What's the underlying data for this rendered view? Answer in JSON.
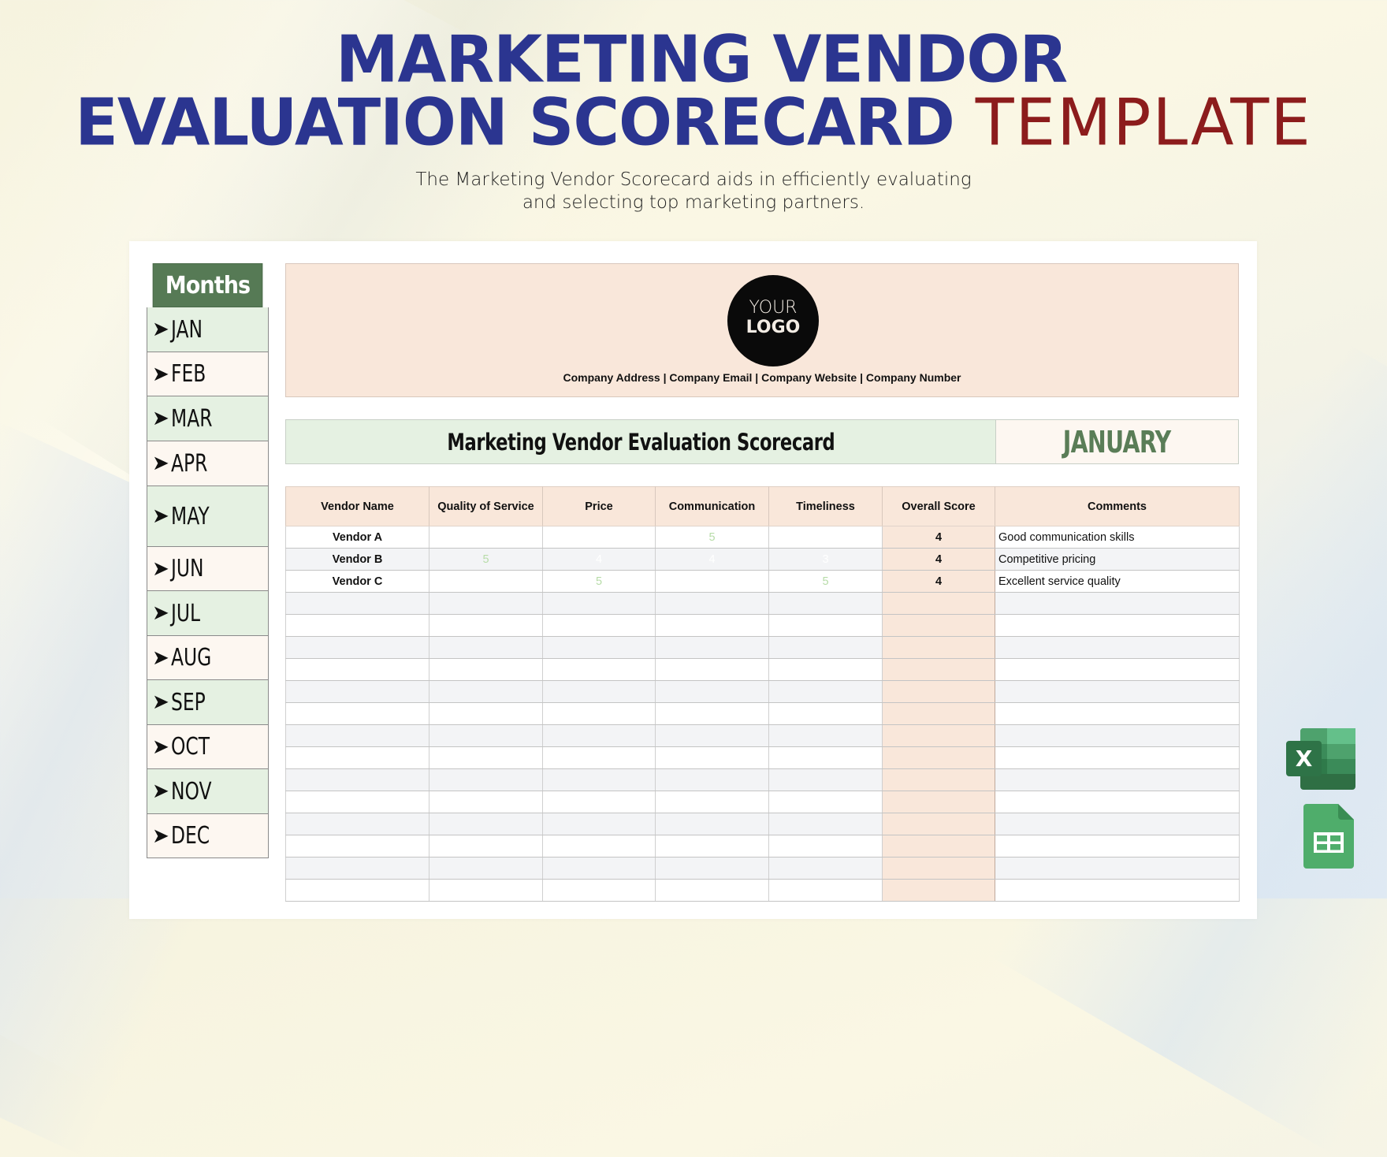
{
  "hero": {
    "title_line1": "MARKETING VENDOR",
    "title_line2_bold": "EVALUATION SCORECARD",
    "title_line2_light": "TEMPLATE",
    "subtitle_line1": "The Marketing Vendor Scorecard aids in efficiently evaluating",
    "subtitle_line2": "and selecting top marketing partners."
  },
  "colors": {
    "title_blue": "#2b3590",
    "template_red": "#8c1c1c",
    "months_header_green": "#567a55",
    "month_green": "#e5f1e2",
    "month_cream": "#fdf7f1",
    "header_peach": "#f9e7da",
    "january_green": "#5a7d57"
  },
  "months": {
    "header": "Months",
    "arrow_icon": "➤",
    "items": [
      "JAN",
      "FEB",
      "MAR",
      "APR",
      "MAY",
      "JUN",
      "JUL",
      "AUG",
      "SEP",
      "OCT",
      "NOV",
      "DEC"
    ]
  },
  "company": {
    "logo_line1": "YOUR",
    "logo_line2": "LOGO",
    "info": "Company Address | Company Email | Company Website | Company Number"
  },
  "scorecard": {
    "title": "Marketing Vendor Evaluation Scorecard",
    "month": "JANUARY"
  },
  "table": {
    "columns": [
      "Vendor Name",
      "Quality of Service",
      "Price",
      "Communication",
      "Timeliness",
      "Overall Score",
      "Comments"
    ],
    "rows": [
      {
        "vendor": "Vendor A",
        "quality": "",
        "price": "",
        "communication": "5",
        "timeliness": "",
        "overall": "4",
        "comments": "Good communication skills"
      },
      {
        "vendor": "Vendor B",
        "quality": "5",
        "price": "4",
        "communication": "4",
        "timeliness": "3",
        "overall": "4",
        "comments": "Competitive pricing"
      },
      {
        "vendor": "Vendor C",
        "quality": "",
        "price": "5",
        "communication": "",
        "timeliness": "5",
        "overall": "4",
        "comments": "Excellent service quality"
      }
    ],
    "empty_row_count": 14
  },
  "app_icons": {
    "excel_letter": "X"
  }
}
